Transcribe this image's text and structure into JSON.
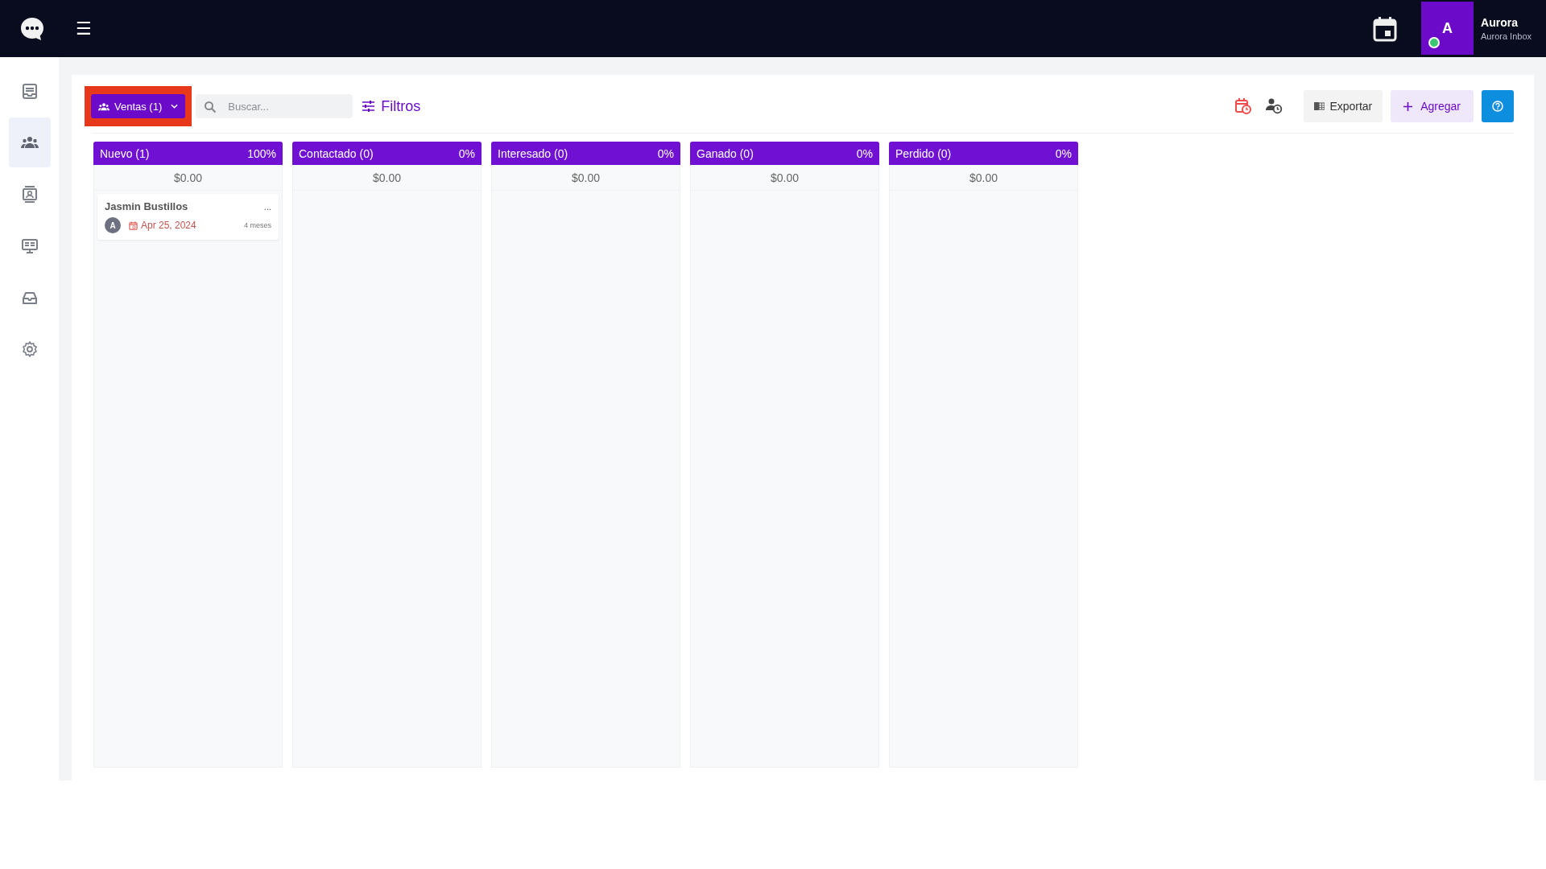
{
  "topbar": {
    "menu_label": "☰",
    "user": {
      "avatar": "A",
      "name": "Aurora",
      "subtitle": "Aurora Inbox",
      "online": true
    }
  },
  "sidebar": {
    "items": [
      {
        "selected": false
      },
      {
        "selected": true
      },
      {
        "selected": false
      },
      {
        "selected": false
      },
      {
        "selected": false
      },
      {
        "selected": false
      }
    ]
  },
  "toolbar": {
    "pipeline": {
      "label": "Ventas (1)",
      "highlighted": true
    },
    "search": {
      "placeholder": "Buscar..."
    },
    "filters": "Filtros",
    "export": "Exportar",
    "add": "Agregar"
  },
  "columns": [
    {
      "title": "Nuevo (1)",
      "percent": "100%",
      "total": "$0.00",
      "cards": [
        {
          "name": "Jasmin Bustillos",
          "menu": "...",
          "avatar": "A",
          "date": "Apr 25, 2024",
          "age": "4 meses"
        }
      ]
    },
    {
      "title": "Contactado (0)",
      "percent": "0%",
      "total": "$0.00"
    },
    {
      "title": "Interesado (0)",
      "percent": "0%",
      "total": "$0.00"
    },
    {
      "title": "Ganado (0)",
      "percent": "0%",
      "total": "$0.00"
    },
    {
      "title": "Perdido (0)",
      "percent": "0%",
      "total": "$0.00"
    }
  ]
}
